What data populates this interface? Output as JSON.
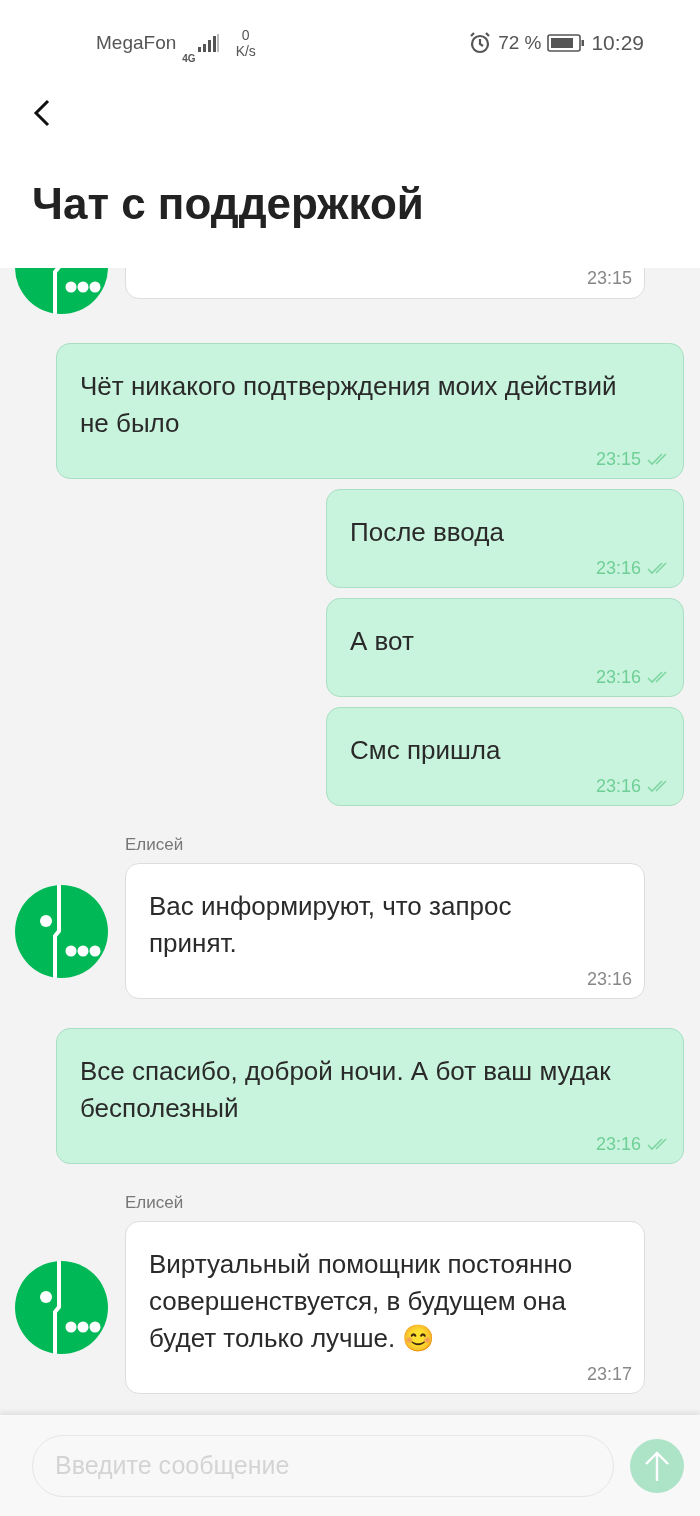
{
  "status_bar": {
    "carrier": "MegaFon",
    "network": "4G",
    "speed_value": "0",
    "speed_unit": "K/s",
    "battery": "72 %",
    "time": "10:29"
  },
  "header": {
    "title": "Чат с поддержкой"
  },
  "messages": [
    {
      "kind": "incoming",
      "time": "23:15"
    },
    {
      "kind": "outgoing",
      "text": "Чёт никакого подтверждения моих действий не было",
      "time": "23:15",
      "read": true
    },
    {
      "kind": "outgoing",
      "text": "После ввода",
      "time": "23:16",
      "read": true
    },
    {
      "kind": "outgoing",
      "text": "А вот",
      "time": "23:16",
      "read": true
    },
    {
      "kind": "outgoing",
      "text": "Смс пришла",
      "time": "23:16",
      "read": true
    },
    {
      "kind": "incoming",
      "sender": "Елисей",
      "text": "Вас информируют, что запрос принят.",
      "time": "23:16"
    },
    {
      "kind": "outgoing",
      "text": "Все спасибо, доброй ночи. А бот ваш мудак бесполезный",
      "time": "23:16",
      "read": true
    },
    {
      "kind": "incoming",
      "sender": "Елисей",
      "text": "Виртуальный помощник постоянно совершенствуется, в будущем она будет только лучше. 😊",
      "time": "23:17"
    }
  ],
  "composer": {
    "placeholder": "Введите сообщение",
    "send_enabled": false
  }
}
